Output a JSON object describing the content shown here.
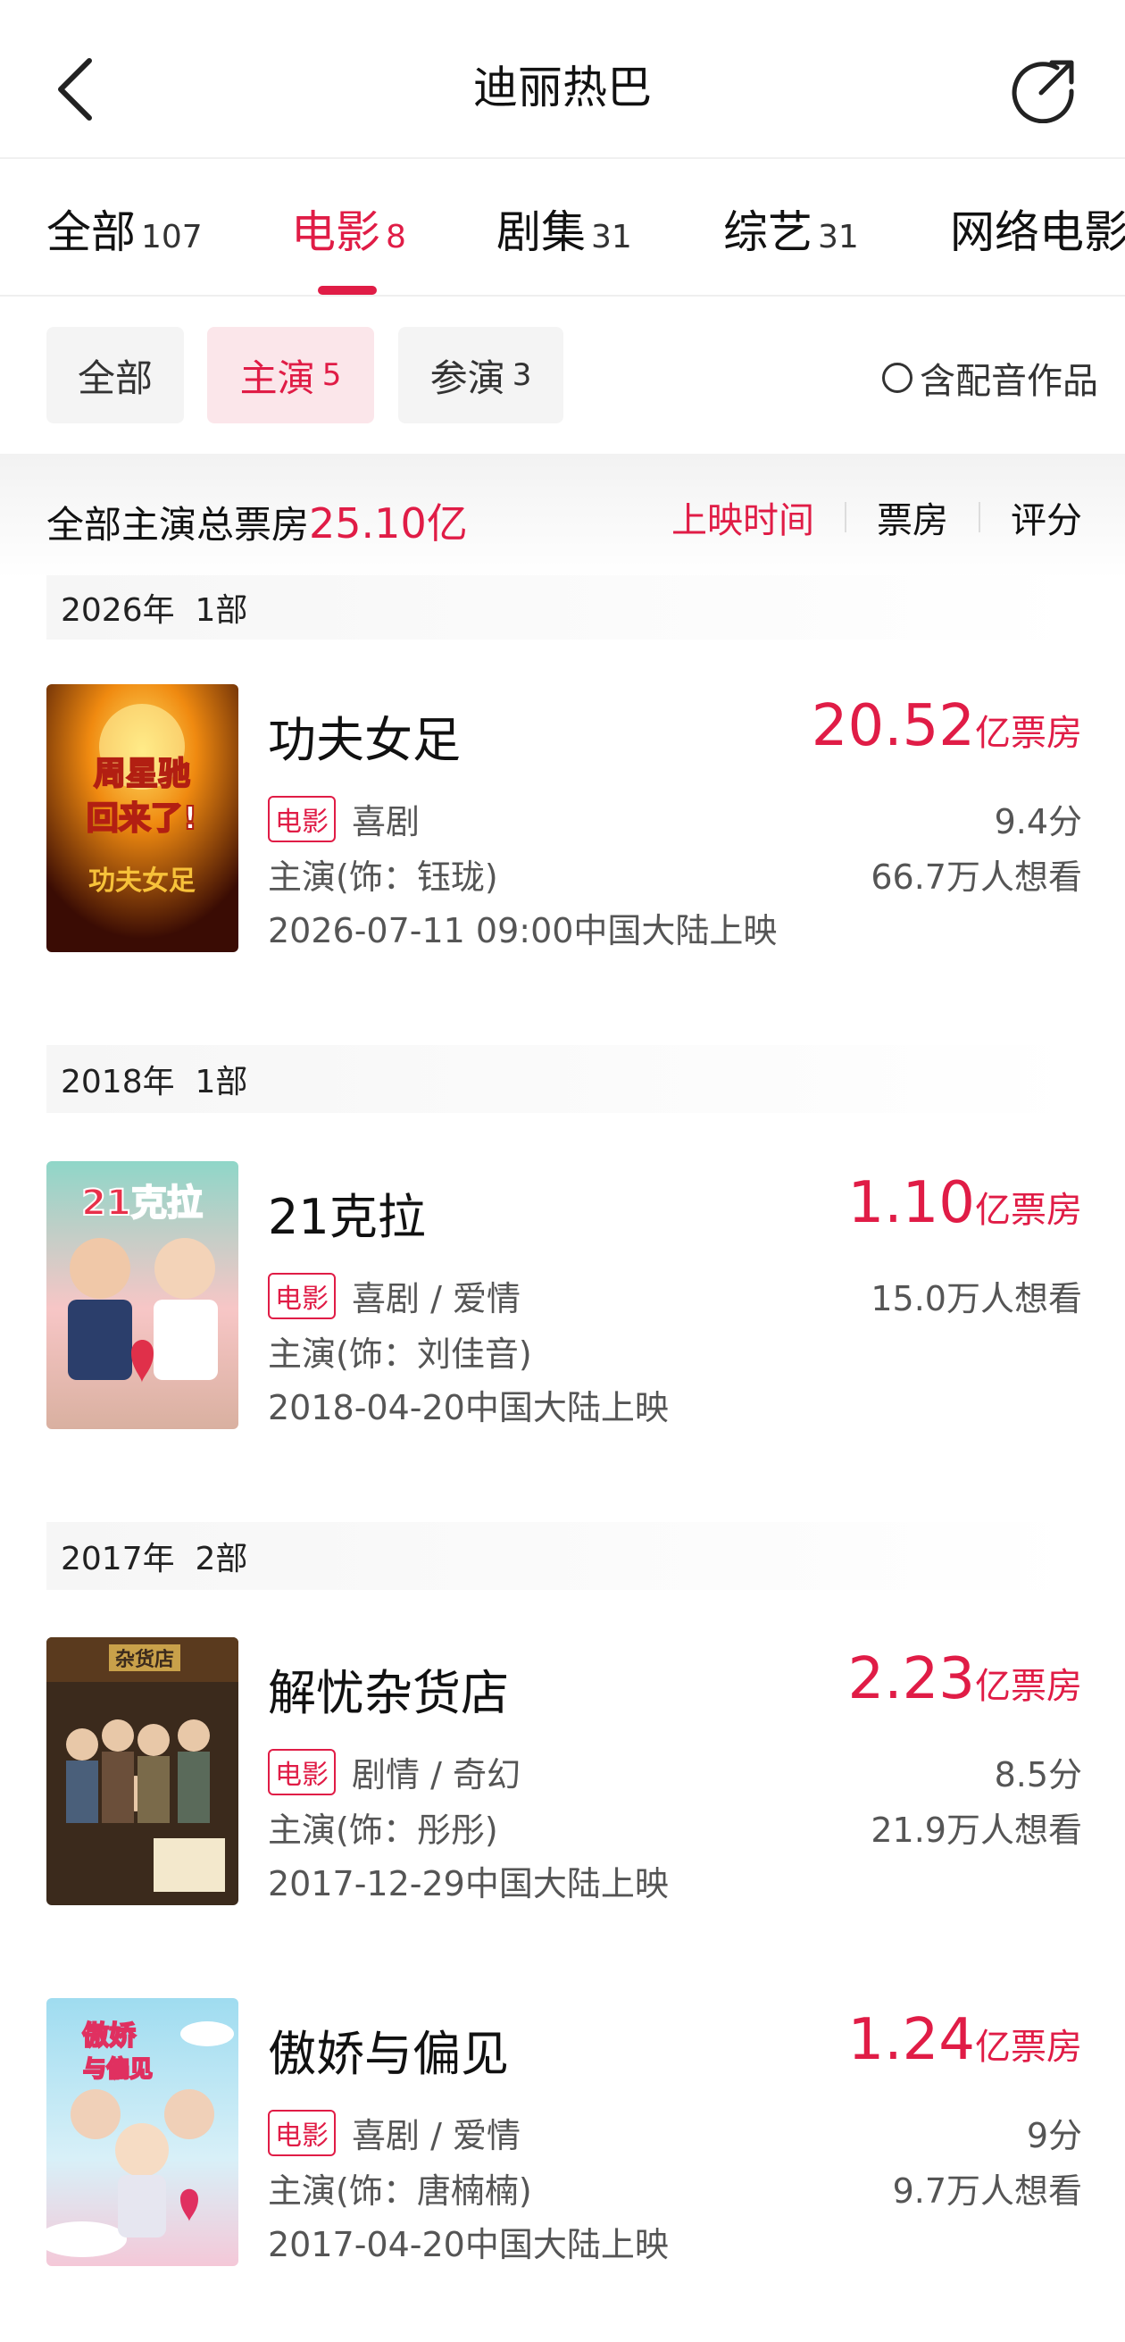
{
  "header": {
    "title": "迪丽热巴"
  },
  "tabs": [
    {
      "label": "全部",
      "count": "107"
    },
    {
      "label": "电影",
      "count": "8"
    },
    {
      "label": "剧集",
      "count": "31"
    },
    {
      "label": "综艺",
      "count": "31"
    },
    {
      "label": "网络电影",
      "count": ""
    }
  ],
  "filters": {
    "chips": [
      {
        "label": "全部",
        "count": ""
      },
      {
        "label": "主演",
        "count": "5"
      },
      {
        "label": "参演",
        "count": "3"
      }
    ],
    "dubbing_label": "含配音作品"
  },
  "summary": {
    "label": "全部主演总票房",
    "value": "25.10亿",
    "sort": [
      "上映时间",
      "票房",
      "评分"
    ]
  },
  "groups": [
    {
      "year": "2026年",
      "count": "1部"
    },
    {
      "year": "2018年",
      "count": "1部"
    },
    {
      "year": "2017年",
      "count": "2部"
    }
  ],
  "movies": [
    {
      "title": "功夫女足",
      "box_num": "20.52",
      "box_unit": "亿票房",
      "tag": "电影",
      "genre": "喜剧",
      "role": "主演(饰：钰珑)",
      "date": "2026-07-11 09:00中国大陆上映",
      "score": "9.4分",
      "want": "66.7万人想看",
      "poster_text": "周星驰回来了!"
    },
    {
      "title": "21克拉",
      "box_num": "1.10",
      "box_unit": "亿票房",
      "tag": "电影",
      "genre": "喜剧 / 爱情",
      "role": "主演(饰：刘佳音)",
      "date": "2018-04-20中国大陆上映",
      "score": "",
      "want": "15.0万人想看",
      "poster_text": "21克拉"
    },
    {
      "title": "解忧杂货店",
      "box_num": "2.23",
      "box_unit": "亿票房",
      "tag": "电影",
      "genre": "剧情 / 奇幻",
      "role": "主演(饰：彤彤)",
      "date": "2017-12-29中国大陆上映",
      "score": "8.5分",
      "want": "21.9万人想看",
      "poster_text": "杂货店"
    },
    {
      "title": "傲娇与偏见",
      "box_num": "1.24",
      "box_unit": "亿票房",
      "tag": "电影",
      "genre": "喜剧 / 爱情",
      "role": "主演(饰：唐楠楠)",
      "date": "2017-04-20中国大陆上映",
      "score": "9分",
      "want": "9.7万人想看",
      "poster_text": "傲娇与偏见"
    }
  ],
  "colors": {
    "accent": "#e01c46"
  }
}
